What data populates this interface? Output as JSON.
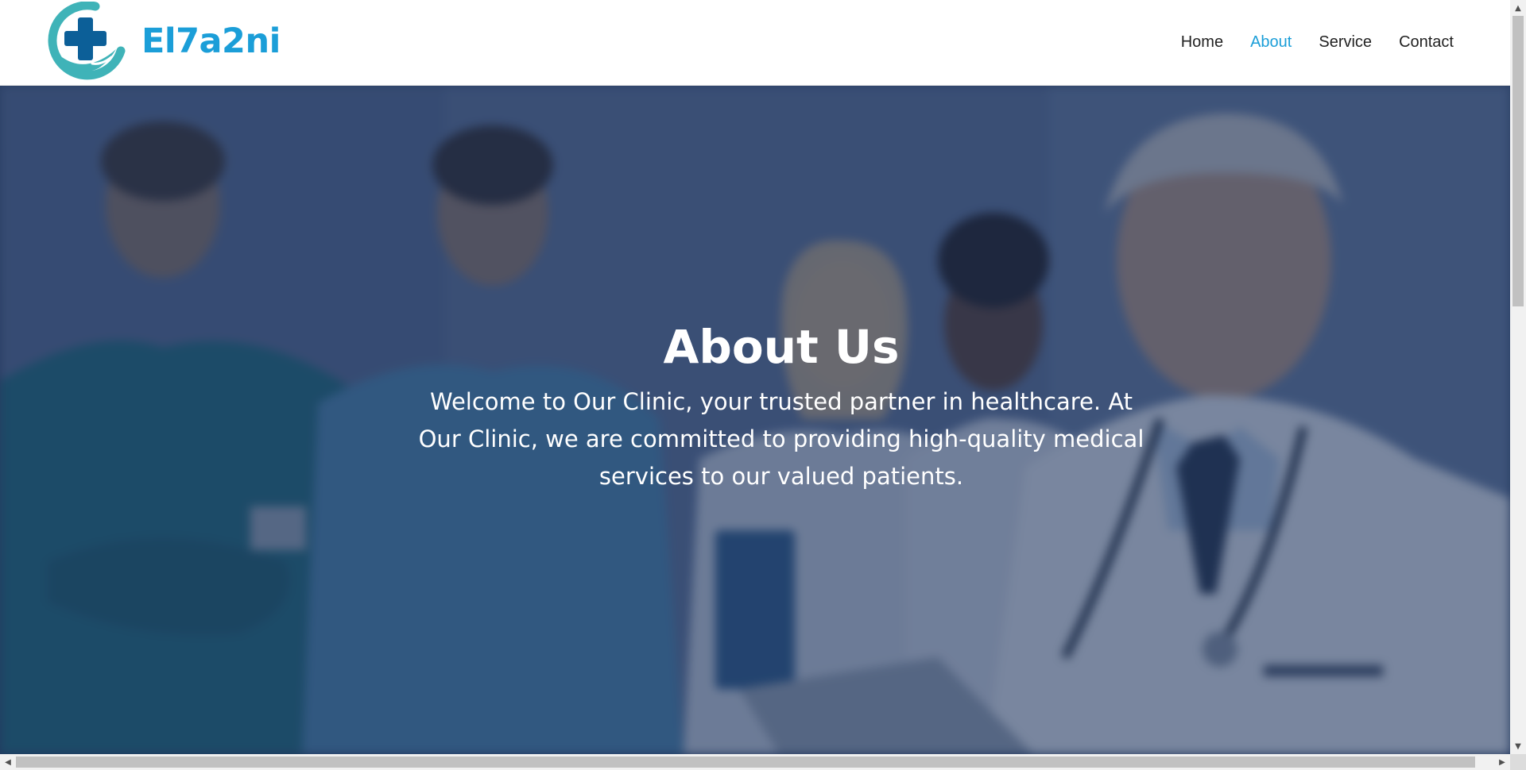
{
  "brand": {
    "name": "El7a2ni",
    "logo_icon": "medical-cross-hand-icon",
    "colors": {
      "primary": "#1b9ed8",
      "teal": "#3fb3b8",
      "cross": "#0c5f98"
    }
  },
  "nav": {
    "items": [
      {
        "label": "Home",
        "active": false
      },
      {
        "label": "About",
        "active": true
      },
      {
        "label": "Service",
        "active": false
      },
      {
        "label": "Contact",
        "active": false
      }
    ],
    "active_color": "#1b9ed8",
    "text_color": "#222222"
  },
  "hero": {
    "title": "About Us",
    "text": "Welcome to Our Clinic, your trusted partner in healthcare. At Our Clinic, we are committed to providing high-quality medical services to our valued patients.",
    "background": "blurred-medical-staff-photo",
    "overlay_color": "#1e325a"
  }
}
